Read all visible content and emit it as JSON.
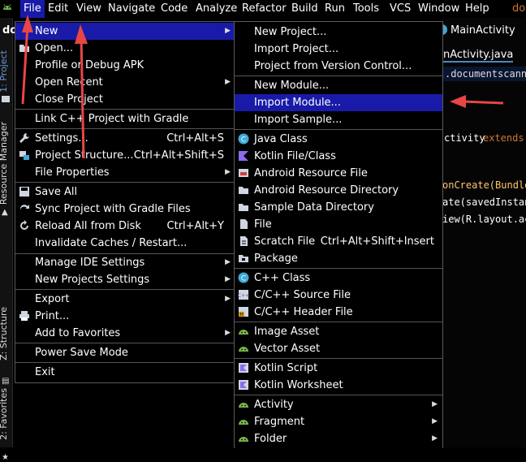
{
  "menubar": {
    "items": [
      "File",
      "Edit",
      "View",
      "Navigate",
      "Code",
      "Analyze",
      "Refactor",
      "Build",
      "Run",
      "Tools",
      "VCS",
      "Window",
      "Help"
    ],
    "project_prefix": "do",
    "right_text": "do"
  },
  "side_tabs": [
    "1: Project",
    "Resource Manager",
    "Z: Structure",
    "2: Favorites"
  ],
  "editor": {
    "tab1": "MainActivity",
    "tab2": "nActivity.java",
    "lines": [
      ".documentscanni",
      "ctivity",
      "extends",
      "onCreate(Bundle",
      "ate(savedInstan",
      "iew(R.layout.ac"
    ]
  },
  "file_menu": {
    "items": [
      {
        "label": "New",
        "arrow": true
      },
      {
        "label": "Open..."
      },
      {
        "label": "Profile or Debug APK"
      },
      {
        "label": "Open Recent",
        "arrow": true
      },
      {
        "label": "Close Project"
      },
      {
        "label": "Link C++ Project with Gradle"
      },
      {
        "label": "Settings...",
        "shortcut": "Ctrl+Alt+S"
      },
      {
        "label": "Project Structure...",
        "shortcut": "Ctrl+Alt+Shift+S"
      },
      {
        "label": "File Properties",
        "arrow": true
      },
      {
        "label": "Save All"
      },
      {
        "label": "Sync Project with Gradle Files"
      },
      {
        "label": "Reload All from Disk",
        "shortcut": "Ctrl+Alt+Y"
      },
      {
        "label": "Invalidate Caches / Restart..."
      },
      {
        "label": "Manage IDE Settings",
        "arrow": true
      },
      {
        "label": "New Projects Settings",
        "arrow": true
      },
      {
        "label": "Export",
        "arrow": true
      },
      {
        "label": "Print..."
      },
      {
        "label": "Add to Favorites",
        "arrow": true
      },
      {
        "label": "Power Save Mode"
      },
      {
        "label": "Exit"
      }
    ]
  },
  "new_menu": {
    "items": [
      {
        "label": "New Project..."
      },
      {
        "label": "Import Project..."
      },
      {
        "label": "Project from Version Control..."
      },
      {
        "label": "New Module..."
      },
      {
        "label": "Import Module..."
      },
      {
        "label": "Import Sample..."
      },
      {
        "label": "Java Class",
        "icon": "java-class-icon"
      },
      {
        "label": "Kotlin File/Class",
        "icon": "kotlin-icon"
      },
      {
        "label": "Android Resource File",
        "icon": "android-resource-file-icon"
      },
      {
        "label": "Android Resource Directory",
        "icon": "folder-icon"
      },
      {
        "label": "Sample Data Directory",
        "icon": "folder-icon"
      },
      {
        "label": "File",
        "icon": "file-icon"
      },
      {
        "label": "Scratch File",
        "shortcut": "Ctrl+Alt+Shift+Insert",
        "icon": "scratch-file-icon"
      },
      {
        "label": "Package",
        "icon": "package-icon"
      },
      {
        "label": "C++ Class",
        "icon": "cpp-class-icon"
      },
      {
        "label": "C/C++ Source File",
        "icon": "cpp-source-icon"
      },
      {
        "label": "C/C++ Header File",
        "icon": "cpp-header-icon"
      },
      {
        "label": "Image Asset",
        "icon": "android-icon"
      },
      {
        "label": "Vector Asset",
        "icon": "android-icon"
      },
      {
        "label": "Kotlin Script",
        "icon": "kotlin-script-icon"
      },
      {
        "label": "Kotlin Worksheet",
        "icon": "kotlin-worksheet-icon"
      },
      {
        "label": "Activity",
        "icon": "android-icon",
        "arrow": true
      },
      {
        "label": "Fragment",
        "icon": "android-icon",
        "arrow": true
      },
      {
        "label": "Folder",
        "icon": "android-icon",
        "arrow": true
      }
    ]
  },
  "colors": {
    "highlight": "#1a1aa8",
    "annotation_arrow": "#e84646",
    "keyword": "#cc7832",
    "android_green": "#7ab648",
    "java_blue": "#3fa9d8"
  }
}
